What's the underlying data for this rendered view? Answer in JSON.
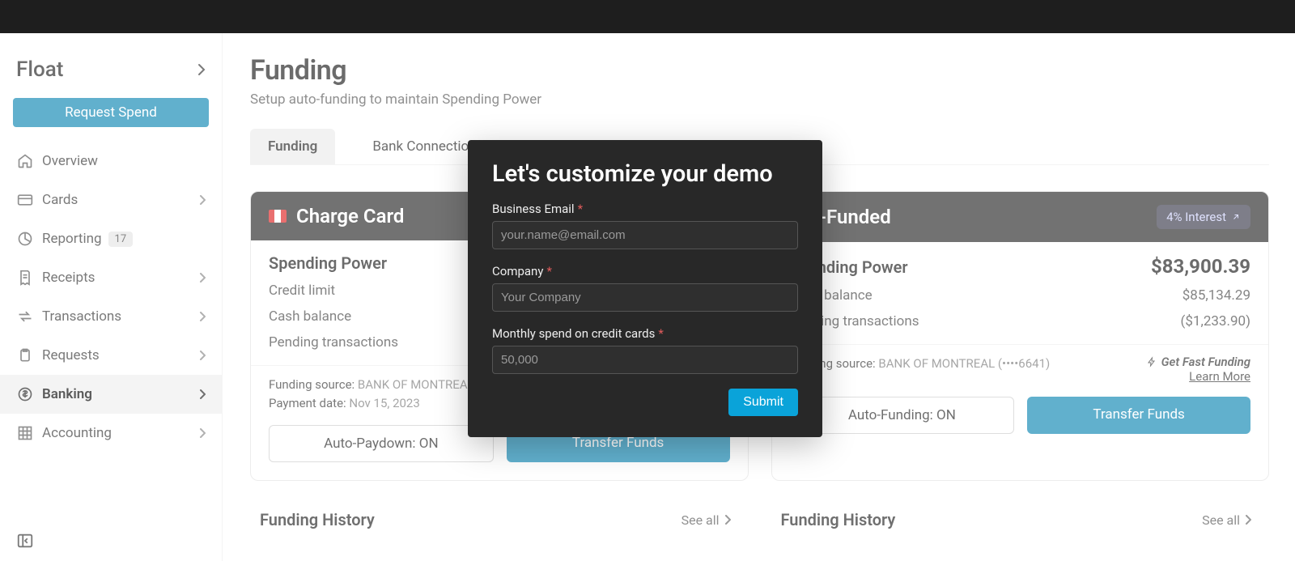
{
  "brand": "Float",
  "request_spend": "Request Spend",
  "nav": {
    "overview": "Overview",
    "cards": "Cards",
    "reporting": "Reporting",
    "reporting_badge": "17",
    "receipts": "Receipts",
    "transactions": "Transactions",
    "requests": "Requests",
    "banking": "Banking",
    "accounting": "Accounting"
  },
  "page": {
    "title": "Funding",
    "subtitle": "Setup auto-funding to maintain Spending Power"
  },
  "tabs": {
    "funding": "Funding",
    "bank_connections": "Bank Connections"
  },
  "charge_card": {
    "title": "Charge Card",
    "spending_power_label": "Spending Power",
    "credit_limit_label": "Credit limit",
    "cash_balance_label": "Cash balance",
    "pending_label": "Pending transactions",
    "funding_source_label": "Funding source:",
    "funding_source_value": "BANK OF MONTREAL (",
    "payment_date_label": "Payment date:",
    "payment_date_value": "Nov 15, 2023",
    "auto_paydown": "Auto-Paydown: ON",
    "transfer": "Transfer Funds"
  },
  "prefunded": {
    "title": "Pre-Funded",
    "interest_pill": "4% Interest",
    "spending_power_label": "Spending Power",
    "spending_power_value": "$83,900.39",
    "cash_balance_label": "Cash balance",
    "cash_balance_value": "$85,134.29",
    "pending_label": "Pending transactions",
    "pending_value": "($1,233.90)",
    "funding_source_label": "Funding source:",
    "funding_source_value": "BANK OF MONTREAL (••••6641)",
    "fast_funding": "Get Fast Funding",
    "learn_more": "Learn More",
    "auto_funding": "Auto-Funding: ON",
    "transfer": "Transfer Funds"
  },
  "history": {
    "title": "Funding History",
    "see_all": "See all"
  },
  "modal": {
    "title": "Let's customize your demo",
    "email_label": "Business Email",
    "email_placeholder": "your.name@email.com",
    "company_label": "Company",
    "company_placeholder": "Your Company",
    "spend_label": "Monthly spend on credit cards",
    "spend_placeholder": "50,000",
    "submit": "Submit"
  }
}
